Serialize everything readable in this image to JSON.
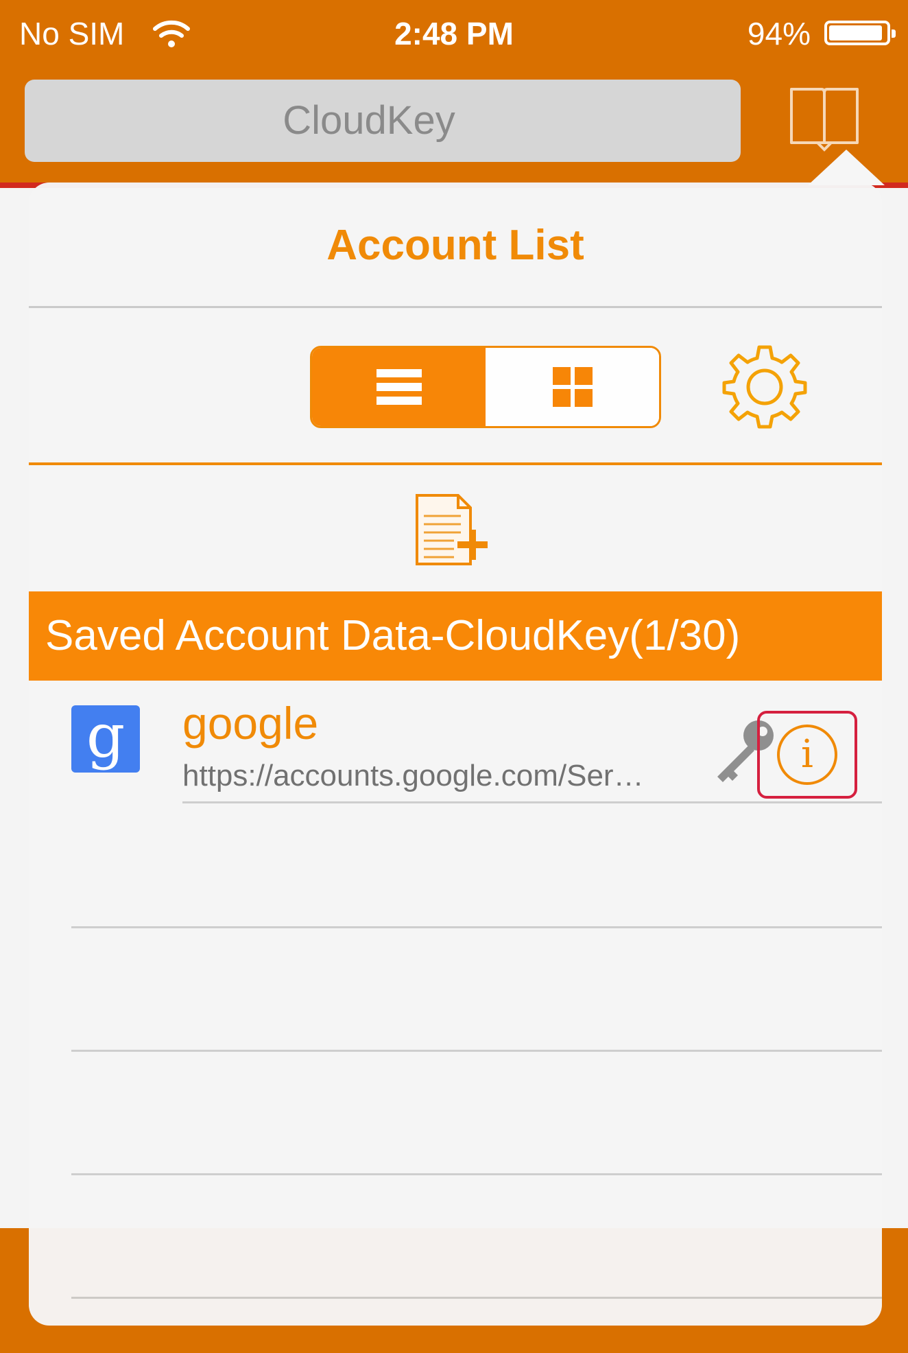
{
  "status_bar": {
    "carrier": "No SIM",
    "time": "2:48 PM",
    "battery_percent": "94%",
    "battery_level": 0.94,
    "wifi_icon": "wifi-icon"
  },
  "nav": {
    "url_text": "CloudKey",
    "bookmark_icon": "book-icon"
  },
  "popover": {
    "title": "Account List",
    "view_toggle": {
      "options": [
        "list",
        "grid"
      ],
      "selected": "list"
    },
    "settings_icon": "gear-icon",
    "add_icon": "add-document-icon",
    "section_header": "Saved Account Data-CloudKey(1/30)",
    "accounts": [
      {
        "name": "google",
        "url": "https://accounts.google.com/Ser…",
        "favicon_letter": "g",
        "key_icon": "key-icon",
        "info_label": "i"
      }
    ]
  },
  "colors": {
    "brand_orange": "#f08700",
    "header_orange": "#f98500",
    "bar_orange": "#d97000",
    "highlight_red": "#d51a3a"
  }
}
